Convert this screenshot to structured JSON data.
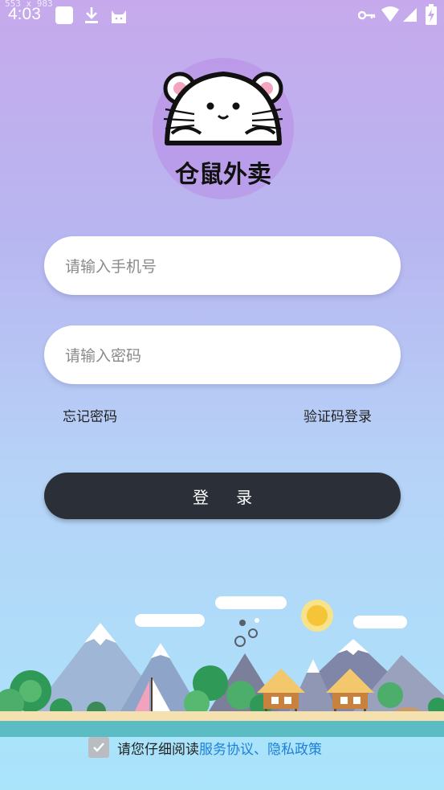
{
  "status_bar": {
    "time": "4:03",
    "dimension_label": "553 x 983",
    "left_icons": [
      "square-app-icon",
      "download-icon",
      "cat-icon"
    ],
    "right_icons": [
      "key-icon",
      "wifi-icon",
      "signal-icon",
      "battery-charging-icon"
    ]
  },
  "logo": {
    "app_name": "仓鼠外卖",
    "circle_color": "#b88ce6"
  },
  "form": {
    "phone_placeholder": "请输入手机号",
    "password_placeholder": "请输入密码",
    "forgot_password": "忘记密码",
    "sms_login": "验证码登录",
    "login_button": "登 录"
  },
  "agreement": {
    "prefix": "请您仔细阅读",
    "terms": "服务协议",
    "separator": "、",
    "privacy": "隐私政策",
    "checked": true
  },
  "colors": {
    "button_bg": "#2b3038",
    "link": "#1f7fd9",
    "checkbox": "#b9bcc1"
  }
}
